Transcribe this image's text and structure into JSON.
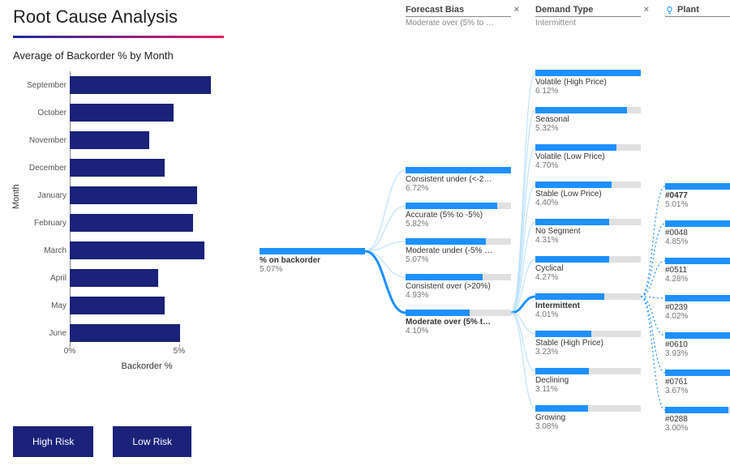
{
  "title": "Root Cause Analysis",
  "chart_title": "Average of Backorder % by Month",
  "y_axis_label": "Month",
  "x_axis_label": "Backorder %",
  "buttons": {
    "high": "High Risk",
    "low": "Low Risk"
  },
  "col_headers": {
    "forecast": {
      "label": "Forecast Bias",
      "sub": "Moderate over (5% to …"
    },
    "demand": {
      "label": "Demand Type",
      "sub": "Intermittent"
    },
    "plant": {
      "label": "Plant",
      "sub": ""
    }
  },
  "root": {
    "label": "% on backorder",
    "value": "5.07%"
  },
  "forecast_bias": [
    {
      "label": "Consistent under (<-2…",
      "value": "6.72%",
      "fill": 100
    },
    {
      "label": "Accurate (5% to -5%)",
      "value": "5.82%",
      "fill": 87
    },
    {
      "label": "Moderate under (-5% …",
      "value": "5.07%",
      "fill": 76
    },
    {
      "label": "Consistent over (>20%)",
      "value": "4.93%",
      "fill": 73
    },
    {
      "label": "Moderate over (5% t…",
      "value": "4.10%",
      "fill": 61,
      "selected": true
    }
  ],
  "demand_type": [
    {
      "label": "Volatile (High Price)",
      "value": "6.12%",
      "fill": 100
    },
    {
      "label": "Seasonal",
      "value": "5.32%",
      "fill": 87
    },
    {
      "label": "Volatile (Low Price)",
      "value": "4.70%",
      "fill": 77
    },
    {
      "label": "Stable (Low Price)",
      "value": "4.40%",
      "fill": 72
    },
    {
      "label": "No Segment",
      "value": "4.31%",
      "fill": 70
    },
    {
      "label": "Cyclical",
      "value": "4.27%",
      "fill": 70
    },
    {
      "label": "Intermittent",
      "value": "4.01%",
      "fill": 65,
      "selected": true
    },
    {
      "label": "Stable (High Price)",
      "value": "3.23%",
      "fill": 53
    },
    {
      "label": "Declining",
      "value": "3.11%",
      "fill": 51
    },
    {
      "label": "Growing",
      "value": "3.08%",
      "fill": 50
    }
  ],
  "plants": [
    {
      "label": "#0477",
      "value": "5.01%",
      "fill": 100,
      "selected": true
    },
    {
      "label": "#0048",
      "value": "4.85%",
      "fill": 97
    },
    {
      "label": "#0511",
      "value": "4.28%",
      "fill": 85
    },
    {
      "label": "#0239",
      "value": "4.02%",
      "fill": 80
    },
    {
      "label": "#0610",
      "value": "3.93%",
      "fill": 78
    },
    {
      "label": "#0761",
      "value": "3.67%",
      "fill": 73
    },
    {
      "label": "#0288",
      "value": "3.00%",
      "fill": 60
    }
  ],
  "chart_data": {
    "type": "bar",
    "orientation": "horizontal",
    "title": "Average of Backorder % by Month",
    "xlabel": "Backorder %",
    "ylabel": "Month",
    "categories": [
      "September",
      "October",
      "November",
      "December",
      "January",
      "February",
      "March",
      "April",
      "May",
      "June"
    ],
    "values": [
      6.4,
      4.7,
      3.6,
      4.3,
      5.8,
      5.6,
      6.1,
      4.0,
      4.3,
      5.0
    ],
    "xlim": [
      0,
      7
    ],
    "x_ticks": [
      0,
      5
    ]
  },
  "x_tick_labels": {
    "t0": "0%",
    "t1": "5%"
  }
}
